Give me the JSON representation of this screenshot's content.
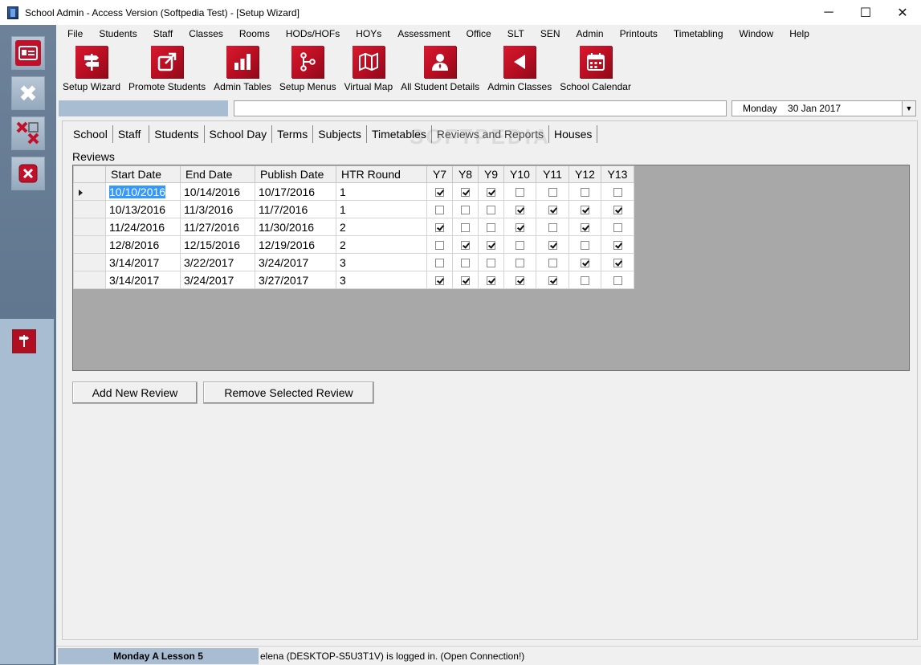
{
  "window": {
    "title": "School Admin - Access Version (Softpedia Test) - [Setup Wizard]",
    "minimize": "─",
    "maximize": "☐",
    "close": "✕"
  },
  "menu": [
    "File",
    "Students",
    "Staff",
    "Classes",
    "Rooms",
    "HODs/HOFs",
    "HOYs",
    "Assessment",
    "Office",
    "SLT",
    "SEN",
    "Admin",
    "Printouts",
    "Timetabling",
    "Window",
    "Help"
  ],
  "toolbar": [
    {
      "label": "Setup Wizard",
      "icon": "signpost-icon"
    },
    {
      "label": "Promote Students",
      "icon": "external-link-icon"
    },
    {
      "label": "Admin Tables",
      "icon": "bar-chart-icon"
    },
    {
      "label": "Setup Menus",
      "icon": "branch-icon"
    },
    {
      "label": "Virtual Map",
      "icon": "map-icon"
    },
    {
      "label": "All Student Details",
      "icon": "person-icon"
    },
    {
      "label": "Admin Classes",
      "icon": "play-back-icon"
    },
    {
      "label": "School Calendar",
      "icon": "calendar-icon"
    }
  ],
  "date_selector": {
    "value": "Monday    30 Jan 2017"
  },
  "tabs": [
    {
      "label": "School",
      "active": false
    },
    {
      "label": "Staff ",
      "active": false
    },
    {
      "label": "Students",
      "active": false
    },
    {
      "label": "School Day",
      "active": false
    },
    {
      "label": "Terms",
      "active": false
    },
    {
      "label": "Subjects",
      "active": false
    },
    {
      "label": "Timetables",
      "active": false
    },
    {
      "label": "Reviews and Reports",
      "active": true
    },
    {
      "label": "Houses",
      "active": false
    }
  ],
  "watermark": "SOFTPEDIA",
  "reviews": {
    "label": "Reviews",
    "columns": [
      "Start Date",
      "End Date",
      "Publish Date",
      "HTR Round",
      "Y7",
      "Y8",
      "Y9",
      "Y10",
      "Y11",
      "Y12",
      "Y13"
    ],
    "rows": [
      {
        "start": "10/10/2016",
        "end": "10/14/2016",
        "publish": "10/17/2016",
        "round": "1",
        "years": [
          true,
          true,
          true,
          false,
          false,
          false,
          false
        ],
        "current": true
      },
      {
        "start": "10/13/2016",
        "end": "11/3/2016",
        "publish": "11/7/2016",
        "round": "1",
        "years": [
          false,
          false,
          false,
          true,
          true,
          true,
          true
        ],
        "current": false
      },
      {
        "start": "11/24/2016",
        "end": "11/27/2016",
        "publish": "11/30/2016",
        "round": "2",
        "years": [
          true,
          false,
          false,
          true,
          false,
          true,
          false
        ],
        "current": false
      },
      {
        "start": "12/8/2016",
        "end": "12/15/2016",
        "publish": "12/19/2016",
        "round": "2",
        "years": [
          false,
          true,
          true,
          false,
          true,
          false,
          true
        ],
        "current": false
      },
      {
        "start": "3/14/2017",
        "end": "3/22/2017",
        "publish": "3/24/2017",
        "round": "3",
        "years": [
          false,
          false,
          false,
          false,
          false,
          true,
          true
        ],
        "current": false
      },
      {
        "start": "3/14/2017",
        "end": "3/24/2017",
        "publish": "3/27/2017",
        "round": "3",
        "years": [
          true,
          true,
          true,
          true,
          true,
          false,
          false
        ],
        "current": false
      }
    ]
  },
  "buttons": {
    "add": "Add New Review",
    "remove": "Remove Selected Review"
  },
  "status": {
    "lesson": "Monday A Lesson 5",
    "text": "elena (DESKTOP-S5U3T1V) is logged in. (Open Connection!)"
  }
}
